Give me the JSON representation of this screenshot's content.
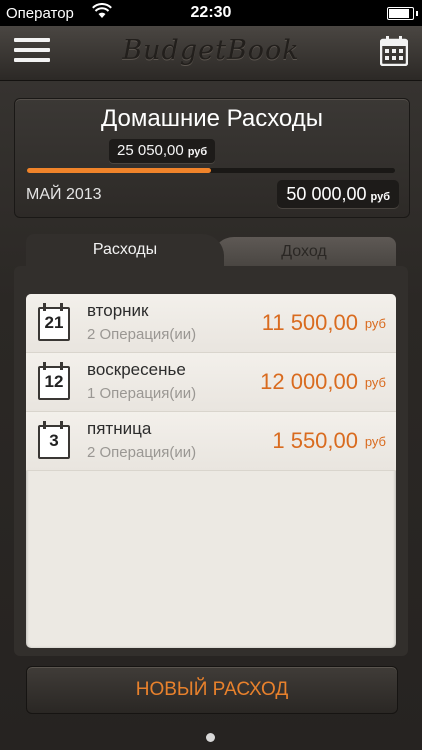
{
  "status_bar": {
    "carrier": "Оператор",
    "time": "22:30"
  },
  "nav": {
    "logo": "BudgetBook"
  },
  "budget": {
    "title": "Домашние Расходы",
    "spent_amount": "25 050,00",
    "spent_currency": "руб",
    "progress_fraction": 0.501,
    "period": "МАЙ 2013",
    "total_amount": "50 000,00",
    "total_currency": "руб"
  },
  "tabs": {
    "expenses": "Расходы",
    "income": "Доход"
  },
  "entries": [
    {
      "date_num": "21",
      "day": "вторник",
      "operations": "2 Операция(ии)",
      "amount": "11 500,00",
      "currency": "руб"
    },
    {
      "date_num": "12",
      "day": "воскресенье",
      "operations": "1 Операция(ии)",
      "amount": "12 000,00",
      "currency": "руб"
    },
    {
      "date_num": "3",
      "day": "пятница",
      "operations": "2 Операция(ии)",
      "amount": "1 550,00",
      "currency": "руб"
    }
  ],
  "new_button": "НОВЫЙ РАСХОД",
  "colors": {
    "accent": "#f0832a",
    "amount": "#d96b1f"
  },
  "icons": {
    "menu": "menu-icon",
    "calendar": "calendar-icon",
    "wifi": "wifi-icon",
    "battery": "battery-icon"
  }
}
